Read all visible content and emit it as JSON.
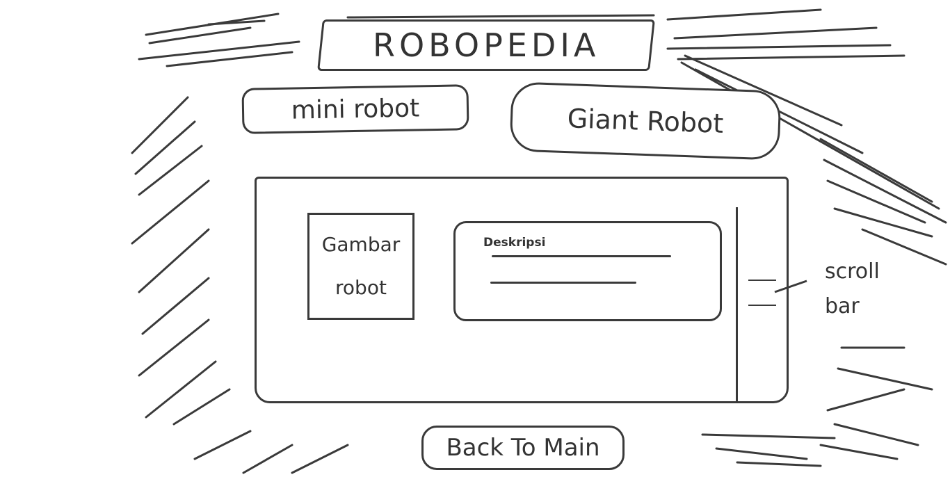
{
  "header": {
    "title": "ROBOPEDIA"
  },
  "nav": {
    "mini_robot_label": "mini robot",
    "giant_robot_label": "Giant Robot"
  },
  "content": {
    "picture_label_line1": "Gambar",
    "picture_label_line2": "robot",
    "description_label": "Deskripsi"
  },
  "scrollbar": {
    "annotation_line1": "scroll",
    "annotation_line2": "bar"
  },
  "footer": {
    "back_label": "Back To Main"
  },
  "colors": {
    "ink": "#3a3a3a",
    "background": "#ffffff"
  }
}
